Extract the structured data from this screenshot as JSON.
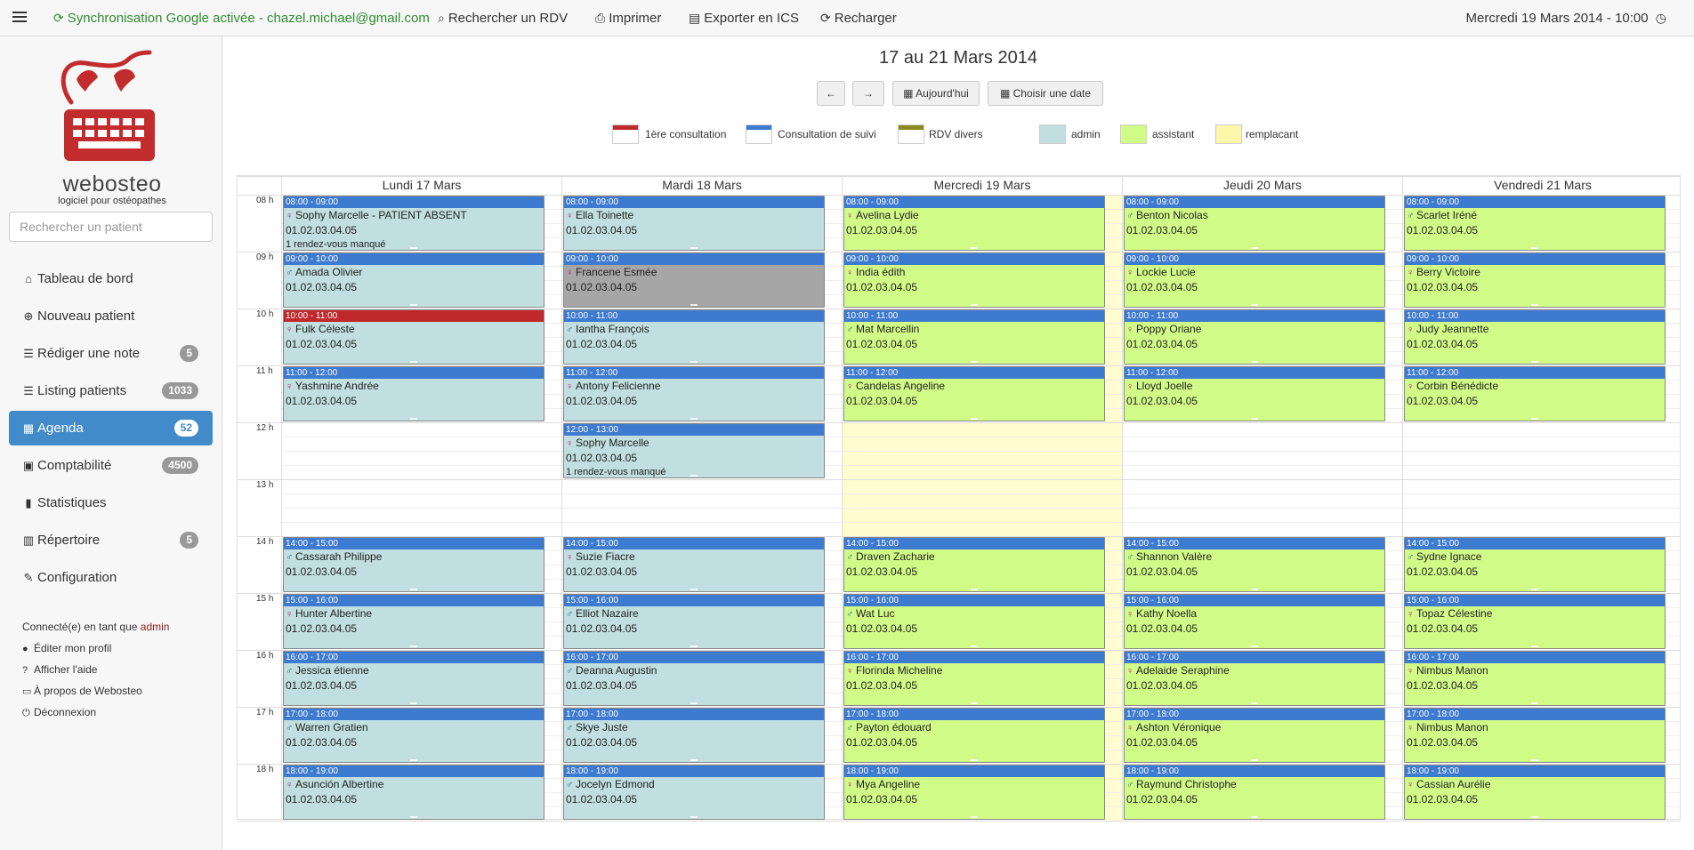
{
  "topbar": {
    "sync_label": "Synchronisation Google activée - chazel.michael@gmail.com",
    "search_label": "Rechercher un RDV",
    "print_label": "Imprimer",
    "export_label": "Exporter en ICS",
    "reload_label": "Recharger",
    "datetime": "Mercredi 19 Mars 2014 - 10:00"
  },
  "sidebar": {
    "logo_word": "webosteo",
    "logo_sub": "logiciel pour ostéopathes",
    "search_placeholder": "Rechercher un patient",
    "items": [
      {
        "label": "Tableau de bord",
        "icon": "home-icon",
        "badge": ""
      },
      {
        "label": "Nouveau patient",
        "icon": "plus-circle-icon",
        "badge": ""
      },
      {
        "label": "Rédiger une note",
        "icon": "list-icon",
        "badge": "5"
      },
      {
        "label": "Listing patients",
        "icon": "list-icon",
        "badge": "1033"
      },
      {
        "label": "Agenda",
        "icon": "calendar-icon",
        "badge": "52",
        "active": true
      },
      {
        "label": "Comptabilité",
        "icon": "calculator-icon",
        "badge": "4500"
      },
      {
        "label": "Statistiques",
        "icon": "bar-chart-icon",
        "badge": ""
      },
      {
        "label": "Répertoire",
        "icon": "book-icon",
        "badge": "5"
      },
      {
        "label": "Configuration",
        "icon": "wrench-icon",
        "badge": ""
      }
    ],
    "connected_prefix": "Connecté(e) en tant que",
    "connected_user": "admin",
    "links": [
      "Éditer mon profil",
      "Afficher l'aide",
      "À propos de Webosteo",
      "Déconnexion"
    ]
  },
  "agenda": {
    "week_title": "17 au 21 Mars 2014",
    "prev_label": "←",
    "next_label": "→",
    "today_label": "Aujourd'hui",
    "choose_date_label": "Choisir une date",
    "legend": [
      {
        "label": "1ère consultation",
        "color": "#c0292b",
        "kind": "bar"
      },
      {
        "label": "Consultation de suivi",
        "color": "#3d7bd0",
        "kind": "bar"
      },
      {
        "label": "RDV divers",
        "color": "#8a8a1c",
        "kind": "bar"
      },
      {
        "label": "admin",
        "color": "#c1dfe0",
        "kind": "fill"
      },
      {
        "label": "assistant",
        "color": "#d1fb87",
        "kind": "fill"
      },
      {
        "label": "remplacant",
        "color": "#fdf8a9",
        "kind": "fill"
      }
    ],
    "days": [
      "Lundi 17 Mars",
      "Mardi 18 Mars",
      "Mercredi 19 Mars",
      "Jeudi 20 Mars",
      "Vendredi 21 Mars"
    ],
    "hours": [
      "08 h",
      "09 h",
      "10 h",
      "11 h",
      "12 h",
      "13 h",
      "14 h",
      "15 h",
      "16 h",
      "17 h",
      "18 h"
    ],
    "colors": {
      "header_suivi": "#3d7bd0",
      "header_first": "#c0292b",
      "admin": "#c1dfe0",
      "assistant": "#d1fb87",
      "cancelled": "#a6a6a6",
      "today_bg": "#fefcd0"
    },
    "appointments": [
      {
        "day": 0,
        "hour": 0,
        "time": "08:00 - 09:00",
        "g": "f",
        "name": "Sophy Marcelle - PATIENT ABSENT",
        "tel": "01.02.03.04.05",
        "extra": "1 rendez-vous manqué",
        "bg": "admin",
        "hdr": "header_suivi"
      },
      {
        "day": 0,
        "hour": 1,
        "time": "09:00 - 10:00",
        "g": "m",
        "name": "Amada Olivier",
        "tel": "01.02.03.04.05",
        "bg": "admin",
        "hdr": "header_suivi"
      },
      {
        "day": 0,
        "hour": 2,
        "time": "10:00 - 11:00",
        "g": "f",
        "name": "Fulk Céleste",
        "tel": "01.02.03.04.05",
        "bg": "admin",
        "hdr": "header_first"
      },
      {
        "day": 0,
        "hour": 3,
        "time": "11:00 - 12:00",
        "g": "f",
        "name": "Yashmine Andrée",
        "tel": "01.02.03.04.05",
        "bg": "admin",
        "hdr": "header_suivi"
      },
      {
        "day": 0,
        "hour": 6,
        "time": "14:00 - 15:00",
        "g": "m",
        "name": "Cassarah Philippe",
        "tel": "01.02.03.04.05",
        "bg": "admin",
        "hdr": "header_suivi"
      },
      {
        "day": 0,
        "hour": 7,
        "time": "15:00 - 16:00",
        "g": "f",
        "name": "Hunter Albertine",
        "tel": "01.02.03.04.05",
        "bg": "admin",
        "hdr": "header_suivi"
      },
      {
        "day": 0,
        "hour": 8,
        "time": "16:00 - 17:00",
        "g": "m",
        "name": "Jessica étienne",
        "tel": "01.02.03.04.05",
        "bg": "admin",
        "hdr": "header_suivi"
      },
      {
        "day": 0,
        "hour": 9,
        "time": "17:00 - 18:00",
        "g": "m",
        "name": "Warren Gratien",
        "tel": "01.02.03.04.05",
        "bg": "admin",
        "hdr": "header_suivi"
      },
      {
        "day": 0,
        "hour": 10,
        "time": "18:00 - 19:00",
        "g": "f",
        "name": "Asunción Albertine",
        "tel": "01.02.03.04.05",
        "bg": "admin",
        "hdr": "header_suivi"
      },
      {
        "day": 1,
        "hour": 0,
        "time": "08:00 - 09:00",
        "g": "f",
        "name": "Ella Toinette",
        "tel": "01.02.03.04.05",
        "bg": "admin",
        "hdr": "header_suivi"
      },
      {
        "day": 1,
        "hour": 1,
        "time": "09:00 - 10:00",
        "g": "f",
        "name": "Francene Esmée",
        "tel": "01.02.03.04.05",
        "bg": "cancelled",
        "hdr": "header_suivi"
      },
      {
        "day": 1,
        "hour": 2,
        "time": "10:00 - 11:00",
        "g": "m",
        "name": "Iantha François",
        "tel": "01.02.03.04.05",
        "bg": "admin",
        "hdr": "header_suivi"
      },
      {
        "day": 1,
        "hour": 3,
        "time": "11:00 - 12:00",
        "g": "f",
        "name": "Antony Felicienne",
        "tel": "01.02.03.04.05",
        "bg": "admin",
        "hdr": "header_suivi"
      },
      {
        "day": 1,
        "hour": 4,
        "time": "12:00 - 13:00",
        "g": "f",
        "name": "Sophy Marcelle",
        "tel": "01.02.03.04.05",
        "extra": "1 rendez-vous manqué",
        "bg": "admin",
        "hdr": "header_suivi"
      },
      {
        "day": 1,
        "hour": 6,
        "time": "14:00 - 15:00",
        "g": "f",
        "name": "Suzie Fiacre",
        "tel": "01.02.03.04.05",
        "bg": "admin",
        "hdr": "header_suivi"
      },
      {
        "day": 1,
        "hour": 7,
        "time": "15:00 - 16:00",
        "g": "m",
        "name": "Elliot Nazaire",
        "tel": "01.02.03.04.05",
        "bg": "admin",
        "hdr": "header_suivi"
      },
      {
        "day": 1,
        "hour": 8,
        "time": "16:00 - 17:00",
        "g": "m",
        "name": "Deanna Augustin",
        "tel": "01.02.03.04.05",
        "bg": "admin",
        "hdr": "header_suivi"
      },
      {
        "day": 1,
        "hour": 9,
        "time": "17:00 - 18:00",
        "g": "m",
        "name": "Skye Juste",
        "tel": "01.02.03.04.05",
        "bg": "admin",
        "hdr": "header_suivi"
      },
      {
        "day": 1,
        "hour": 10,
        "time": "18:00 - 19:00",
        "g": "m",
        "name": "Jocelyn Edmond",
        "tel": "01.02.03.04.05",
        "bg": "admin",
        "hdr": "header_suivi"
      },
      {
        "day": 2,
        "hour": 0,
        "time": "08:00 - 09:00",
        "g": "f",
        "name": "Avelina Lydie",
        "tel": "01.02.03.04.05",
        "bg": "assistant",
        "hdr": "header_suivi"
      },
      {
        "day": 2,
        "hour": 1,
        "time": "09:00 - 10:00",
        "g": "f",
        "name": "India édith",
        "tel": "01.02.03.04.05",
        "bg": "assistant",
        "hdr": "header_suivi"
      },
      {
        "day": 2,
        "hour": 2,
        "time": "10:00 - 11:00",
        "g": "m",
        "name": "Mat Marcellin",
        "tel": "01.02.03.04.05",
        "bg": "assistant",
        "hdr": "header_suivi"
      },
      {
        "day": 2,
        "hour": 3,
        "time": "11:00 - 12:00",
        "g": "f",
        "name": "Candelas Angeline",
        "tel": "01.02.03.04.05",
        "bg": "assistant",
        "hdr": "header_suivi"
      },
      {
        "day": 2,
        "hour": 6,
        "time": "14:00 - 15:00",
        "g": "m",
        "name": "Draven Zacharie",
        "tel": "01.02.03.04.05",
        "bg": "assistant",
        "hdr": "header_suivi"
      },
      {
        "day": 2,
        "hour": 7,
        "time": "15:00 - 16:00",
        "g": "m",
        "name": "Wat Luc",
        "tel": "01.02.03.04.05",
        "bg": "assistant",
        "hdr": "header_suivi"
      },
      {
        "day": 2,
        "hour": 8,
        "time": "16:00 - 17:00",
        "g": "f",
        "name": "Florinda Micheline",
        "tel": "01.02.03.04.05",
        "bg": "assistant",
        "hdr": "header_suivi"
      },
      {
        "day": 2,
        "hour": 9,
        "time": "17:00 - 18:00",
        "g": "m",
        "name": "Payton édouard",
        "tel": "01.02.03.04.05",
        "bg": "assistant",
        "hdr": "header_suivi"
      },
      {
        "day": 2,
        "hour": 10,
        "time": "18:00 - 19:00",
        "g": "f",
        "name": "Mya Angeline",
        "tel": "01.02.03.04.05",
        "bg": "assistant",
        "hdr": "header_suivi"
      },
      {
        "day": 3,
        "hour": 0,
        "time": "08:00 - 09:00",
        "g": "m",
        "name": "Benton Nicolas",
        "tel": "01.02.03.04.05",
        "bg": "assistant",
        "hdr": "header_suivi"
      },
      {
        "day": 3,
        "hour": 1,
        "time": "09:00 - 10:00",
        "g": "f",
        "name": "Lockie Lucie",
        "tel": "01.02.03.04.05",
        "bg": "assistant",
        "hdr": "header_suivi"
      },
      {
        "day": 3,
        "hour": 2,
        "time": "10:00 - 11:00",
        "g": "f",
        "name": "Poppy Oriane",
        "tel": "01.02.03.04.05",
        "bg": "assistant",
        "hdr": "header_suivi"
      },
      {
        "day": 3,
        "hour": 3,
        "time": "11:00 - 12:00",
        "g": "f",
        "name": "Lloyd Joelle",
        "tel": "01.02.03.04.05",
        "bg": "assistant",
        "hdr": "header_suivi"
      },
      {
        "day": 3,
        "hour": 6,
        "time": "14:00 - 15:00",
        "g": "m",
        "name": "Shannon Valère",
        "tel": "01.02.03.04.05",
        "bg": "assistant",
        "hdr": "header_suivi"
      },
      {
        "day": 3,
        "hour": 7,
        "time": "15:00 - 16:00",
        "g": "f",
        "name": "Kathy Noella",
        "tel": "01.02.03.04.05",
        "bg": "assistant",
        "hdr": "header_suivi"
      },
      {
        "day": 3,
        "hour": 8,
        "time": "16:00 - 17:00",
        "g": "f",
        "name": "Adelaide Seraphine",
        "tel": "01.02.03.04.05",
        "bg": "assistant",
        "hdr": "header_suivi"
      },
      {
        "day": 3,
        "hour": 9,
        "time": "17:00 - 18:00",
        "g": "f",
        "name": "Ashton Véronique",
        "tel": "01.02.03.04.05",
        "bg": "assistant",
        "hdr": "header_suivi"
      },
      {
        "day": 3,
        "hour": 10,
        "time": "18:00 - 19:00",
        "g": "m",
        "name": "Raymund Christophe",
        "tel": "01.02.03.04.05",
        "bg": "assistant",
        "hdr": "header_suivi"
      },
      {
        "day": 4,
        "hour": 0,
        "time": "08:00 - 09:00",
        "g": "m",
        "name": "Scarlet Iréné",
        "tel": "01.02.03.04.05",
        "bg": "assistant",
        "hdr": "header_suivi"
      },
      {
        "day": 4,
        "hour": 1,
        "time": "09:00 - 10:00",
        "g": "f",
        "name": "Berry Victoire",
        "tel": "01.02.03.04.05",
        "bg": "assistant",
        "hdr": "header_suivi"
      },
      {
        "day": 4,
        "hour": 2,
        "time": "10:00 - 11:00",
        "g": "f",
        "name": "Judy Jeannette",
        "tel": "01.02.03.04.05",
        "bg": "assistant",
        "hdr": "header_suivi"
      },
      {
        "day": 4,
        "hour": 3,
        "time": "11:00 - 12:00",
        "g": "f",
        "name": "Corbin Bénédicte",
        "tel": "01.02.03.04.05",
        "bg": "assistant",
        "hdr": "header_suivi"
      },
      {
        "day": 4,
        "hour": 6,
        "time": "14:00 - 15:00",
        "g": "m",
        "name": "Sydne Ignace",
        "tel": "01.02.03.04.05",
        "bg": "assistant",
        "hdr": "header_suivi"
      },
      {
        "day": 4,
        "hour": 7,
        "time": "15:00 - 16:00",
        "g": "f",
        "name": "Topaz Célestine",
        "tel": "01.02.03.04.05",
        "bg": "assistant",
        "hdr": "header_suivi"
      },
      {
        "day": 4,
        "hour": 8,
        "time": "16:00 - 17:00",
        "g": "f",
        "name": "Nimbus Manon",
        "tel": "01.02.03.04.05",
        "bg": "assistant",
        "hdr": "header_suivi"
      },
      {
        "day": 4,
        "hour": 9,
        "time": "17:00 - 18:00",
        "g": "f",
        "name": "Nimbus Manon",
        "tel": "01.02.03.04.05",
        "bg": "assistant",
        "hdr": "header_suivi"
      },
      {
        "day": 4,
        "hour": 10,
        "time": "18:00 - 19:00",
        "g": "f",
        "name": "Cassian Aurélie",
        "tel": "01.02.03.04.05",
        "bg": "assistant",
        "hdr": "header_suivi"
      }
    ]
  }
}
